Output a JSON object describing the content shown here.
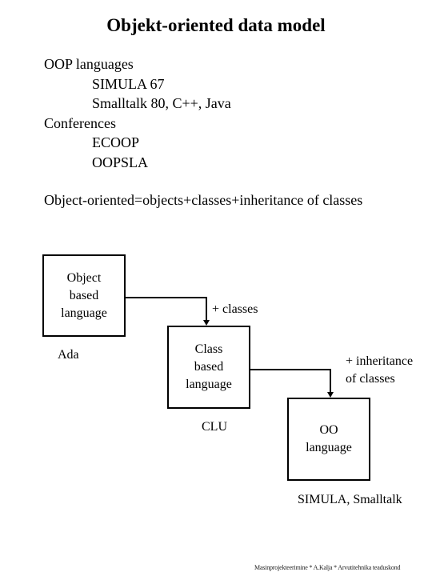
{
  "title": "Objekt-oriented data model",
  "lists": [
    {
      "heading": "OOP languages",
      "items": [
        "SIMULA 67",
        "Smalltalk 80, C++, Java"
      ]
    },
    {
      "heading": "Conferences",
      "items": [
        "ECOOP",
        "OOPSLA"
      ]
    }
  ],
  "definition": "Object-oriented=objects+classes+inheritance of classes",
  "diagram": {
    "boxes": [
      {
        "label": [
          "Object",
          "based",
          "language"
        ],
        "example": "Ada"
      },
      {
        "label": [
          "Class",
          "based",
          "language"
        ],
        "example": "CLU"
      },
      {
        "label": [
          "OO",
          "language"
        ],
        "example": "SIMULA, Smalltalk"
      }
    ],
    "edges": [
      {
        "label": [
          "+ classes"
        ]
      },
      {
        "label": [
          "+ inheritance",
          "of classes"
        ]
      }
    ]
  },
  "footer": "Masinprojekteerimine * A.Kalja * Arvutitehnika teaduskond"
}
